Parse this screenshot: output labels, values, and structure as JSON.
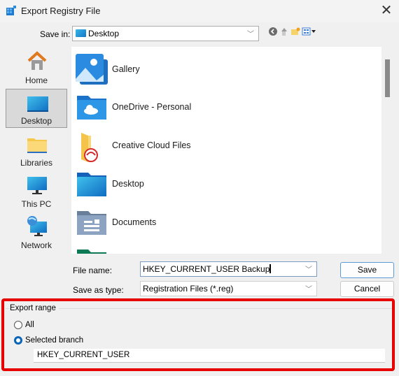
{
  "window": {
    "title": "Export Registry File",
    "close_icon": "close-icon"
  },
  "save_in": {
    "label": "Save in:",
    "value": "Desktop"
  },
  "toolbar": {
    "icons": [
      "back-icon",
      "up-folder-icon",
      "new-folder-icon",
      "view-menu-icon"
    ]
  },
  "places": [
    {
      "label": "Home",
      "icon": "home-icon",
      "selected": false
    },
    {
      "label": "Desktop",
      "icon": "desktop-icon",
      "selected": true
    },
    {
      "label": "Libraries",
      "icon": "libraries-icon",
      "selected": false
    },
    {
      "label": "This PC",
      "icon": "computer-icon",
      "selected": false
    },
    {
      "label": "Network",
      "icon": "network-icon",
      "selected": false
    }
  ],
  "files": [
    {
      "name": "Gallery",
      "icon": "gallery-icon"
    },
    {
      "name": "OneDrive - Personal",
      "icon": "onedrive-folder-icon"
    },
    {
      "name": "Creative Cloud Files",
      "icon": "creative-cloud-folder-icon"
    },
    {
      "name": "Desktop",
      "icon": "desktop-folder-icon"
    },
    {
      "name": "Documents",
      "icon": "documents-folder-icon"
    },
    {
      "name": "",
      "icon": "folder-icon"
    }
  ],
  "form": {
    "file_name_label": "File name:",
    "file_name_value": "HKEY_CURRENT_USER Backup",
    "save_type_label": "Save as type:",
    "save_type_value": "Registration Files (*.reg)",
    "save_button": "Save",
    "cancel_button": "Cancel"
  },
  "export_range": {
    "title": "Export range",
    "options": [
      {
        "label": "All",
        "selected": false
      },
      {
        "label": "Selected branch",
        "selected": true
      }
    ],
    "branch_value": "HKEY_CURRENT_USER"
  }
}
